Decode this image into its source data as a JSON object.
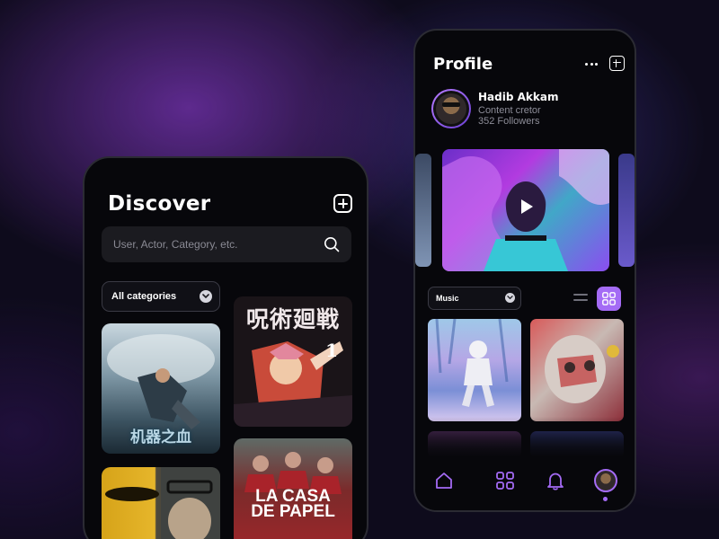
{
  "discover": {
    "title": "Discover",
    "search_placeholder": "User, Actor, Category, etc.",
    "category": "All categories",
    "posters": {
      "p1_title": "机器之血",
      "p2_title": "呪術廻戦",
      "p2_volume": "1",
      "p4_line1": "LA CASA",
      "p4_line2": "DE PAPEL"
    }
  },
  "profile": {
    "title": "Profile",
    "user_name": "Hadib Akkam",
    "user_role": "Content cretor",
    "followers": "352 Followers",
    "filter": "Music"
  },
  "colors": {
    "accent": "#a46bf5",
    "background": "#0e0b1c",
    "phone": "#07070b"
  },
  "icons": {
    "add": "plus-square-icon",
    "search": "search-icon",
    "more": "more-dots-icon",
    "chevron": "chevron-down-icon",
    "list_view": "list-view-icon",
    "grid_view": "grid-view-icon",
    "home": "home-icon",
    "apps": "grid-icon",
    "notifications": "bell-icon"
  }
}
